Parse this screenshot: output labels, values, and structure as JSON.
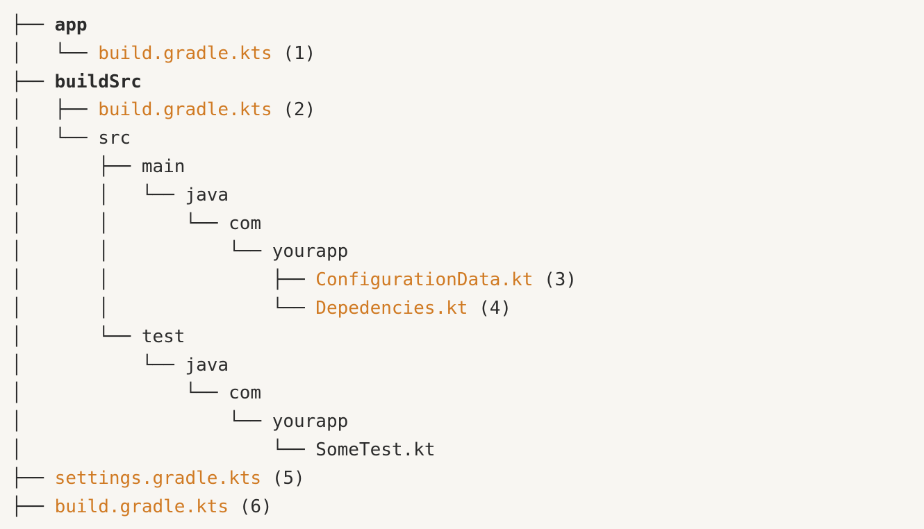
{
  "colors": {
    "background": "#f8f6f2",
    "text": "#2b2b2b",
    "file_highlight": "#d07a23"
  },
  "tree": {
    "rows": [
      {
        "guide": "├── ",
        "name": "app",
        "kind": "dir-bold",
        "note": ""
      },
      {
        "guide": "│   └── ",
        "name": "build.gradle.kts",
        "kind": "file",
        "note": " (1)"
      },
      {
        "guide": "├── ",
        "name": "buildSrc",
        "kind": "dir-bold",
        "note": ""
      },
      {
        "guide": "│   ├── ",
        "name": "build.gradle.kts",
        "kind": "file",
        "note": " (2)"
      },
      {
        "guide": "│   └── ",
        "name": "src",
        "kind": "dir",
        "note": ""
      },
      {
        "guide": "│       ├── ",
        "name": "main",
        "kind": "dir",
        "note": ""
      },
      {
        "guide": "│       │   └── ",
        "name": "java",
        "kind": "dir",
        "note": ""
      },
      {
        "guide": "│       │       └── ",
        "name": "com",
        "kind": "dir",
        "note": ""
      },
      {
        "guide": "│       │           └── ",
        "name": "yourapp",
        "kind": "dir",
        "note": ""
      },
      {
        "guide": "│       │               ├── ",
        "name": "ConfigurationData.kt",
        "kind": "file",
        "note": " (3)"
      },
      {
        "guide": "│       │               └── ",
        "name": "Depedencies.kt",
        "kind": "file",
        "note": " (4)"
      },
      {
        "guide": "│       └── ",
        "name": "test",
        "kind": "dir",
        "note": ""
      },
      {
        "guide": "│           └── ",
        "name": "java",
        "kind": "dir",
        "note": ""
      },
      {
        "guide": "│               └── ",
        "name": "com",
        "kind": "dir",
        "note": ""
      },
      {
        "guide": "│                   └── ",
        "name": "yourapp",
        "kind": "dir",
        "note": ""
      },
      {
        "guide": "│                       └── ",
        "name": "SomeTest.kt",
        "kind": "plain-file",
        "note": ""
      },
      {
        "guide": "├── ",
        "name": "settings.gradle.kts",
        "kind": "file",
        "note": " (5)"
      },
      {
        "guide": "├── ",
        "name": "build.gradle.kts",
        "kind": "file",
        "note": " (6)"
      }
    ]
  }
}
